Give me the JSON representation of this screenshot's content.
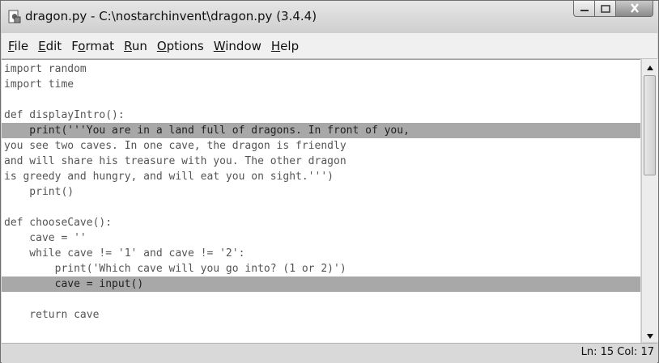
{
  "window": {
    "title": "dragon.py - C:\\nostarchinvent\\dragon.py (3.4.4)",
    "controls": {
      "minimize": "minimize-icon",
      "maximize": "maximize-icon",
      "close": "close-icon"
    }
  },
  "menu": {
    "items": [
      {
        "label": "File",
        "mnemonic": "F",
        "rest": "ile"
      },
      {
        "label": "Edit",
        "mnemonic": "E",
        "rest": "dit"
      },
      {
        "label": "Format",
        "pre": "F",
        "mnemonic": "o",
        "rest": "rmat"
      },
      {
        "label": "Run",
        "mnemonic": "R",
        "rest": "un"
      },
      {
        "label": "Options",
        "mnemonic": "O",
        "rest": "ptions"
      },
      {
        "label": "Window",
        "mnemonic": "W",
        "rest": "indow"
      },
      {
        "label": "Help",
        "mnemonic": "H",
        "rest": "elp"
      }
    ]
  },
  "code": {
    "lines": [
      "import random",
      "import time",
      "",
      "def displayIntro():",
      "    print('''You are in a land full of dragons. In front of you,",
      "you see two caves. In one cave, the dragon is friendly",
      "and will share his treasure with you. The other dragon",
      "is greedy and hungry, and will eat you on sight.''')",
      "    print()",
      "",
      "def chooseCave():",
      "    cave = ''",
      "    while cave != '1' and cave != '2':",
      "        print('Which cave will you go into? (1 or 2)')",
      "        cave = input()",
      "",
      "    return cave"
    ],
    "highlighted_lines": [
      5,
      15
    ]
  },
  "status": {
    "position": "Ln: 15  Col: 17"
  },
  "colors": {
    "highlight": "#a8a8a8",
    "chrome": "#d8d8d8"
  }
}
